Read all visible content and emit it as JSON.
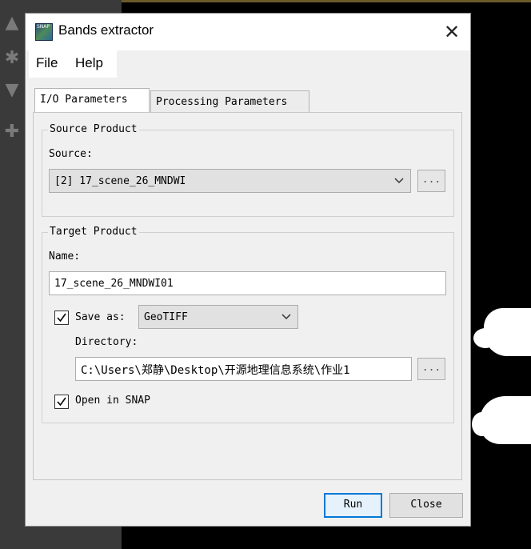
{
  "dialog": {
    "title": "Bands extractor",
    "icon_label": "SNAP"
  },
  "menu": {
    "file": "File",
    "help": "Help"
  },
  "tabs": [
    {
      "label": "I/O Parameters"
    },
    {
      "label": "Processing Parameters"
    }
  ],
  "source_product": {
    "group_title": "Source Product",
    "source_label": "Source:",
    "source_value": "[2] 17_scene_26_MNDWI",
    "browse_label": "..."
  },
  "target_product": {
    "group_title": "Target Product",
    "name_label": "Name:",
    "name_value": "17_scene_26_MNDWI01",
    "save_as_label": "Save as:",
    "save_as_checked": true,
    "format_value": "GeoTIFF",
    "directory_label": "Directory:",
    "directory_value": "C:\\Users\\郑静\\Desktop\\开源地理信息系统\\作业1",
    "browse_label": "...",
    "open_in_snap_label": "Open in SNAP",
    "open_in_snap_checked": true
  },
  "buttons": {
    "run": "Run",
    "close": "Close"
  },
  "colors": {
    "default_button_border": "#0078d7",
    "dialog_bg": "#f0f0f0"
  }
}
